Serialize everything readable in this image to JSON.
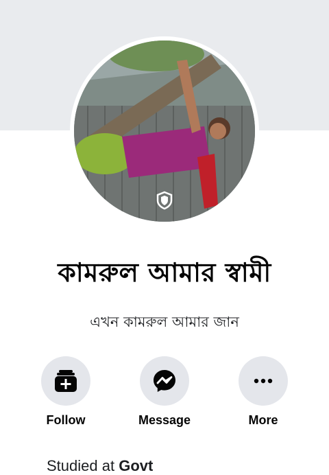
{
  "profile": {
    "name": "কামরুল আমার স্বামী",
    "bio": "এখন কামরুল আমার জান"
  },
  "actions": [
    {
      "label": "Follow",
      "icon": "follow-plus-icon"
    },
    {
      "label": "Message",
      "icon": "messenger-icon"
    },
    {
      "label": "More",
      "icon": "more-dots-icon"
    }
  ],
  "intro": {
    "studied_prefix": "Studied at",
    "studied_school": "Govt"
  },
  "colors": {
    "cover": "#e9ebee",
    "button_bg": "#e4e6eb",
    "text": "#050505"
  }
}
